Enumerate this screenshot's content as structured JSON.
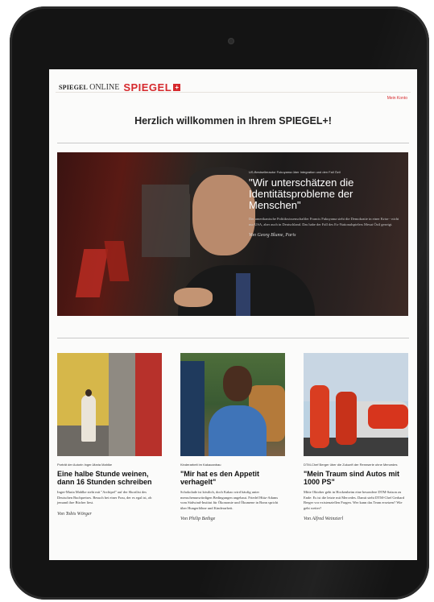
{
  "site": {
    "brand_spiegel": "SPIEGEL",
    "brand_online": "ONLINE",
    "brand_plus": "SPIEGEL",
    "brand_plus_sign": "+",
    "account_link": "Mein Konto"
  },
  "welcome": "Herzlich willkommen in Ihrem SPIEGEL+!",
  "hero": {
    "kicker": "US-Bestsellerautor Fukuyama über Integration und den Fall Özil",
    "title": "\"Wir unterschätzen die Identitätsprobleme der Menschen\"",
    "teaser": "Der amerikanische Politikwissenschaftler Francis Fukuyama sieht die Demokratie in einer Krise - nicht nur USA, aber auch in Deutschland. Das habe der Fall des Ex-Nationalspielers Mesut Özil gezeigt.",
    "author": "Von Georg Blume, Paris"
  },
  "articles": [
    {
      "kicker": "Porträt der Autorin Inger-Maria Mahlke",
      "title": "Eine halbe Stunde weinen, dann 16 Stunden schreiben",
      "teaser": "Inger-Maria Mahlke steht mit \"Archipel\" auf der Shortlist des Deutschen Buchpreises. Besuch bei einer Frau, der es egal ist, ob jemand ihre Bücher liest.",
      "author": "Von Tobis Wörger"
    },
    {
      "kicker": "Kinderarbeit im Kakaoanbau",
      "title": "\"Mir hat es den Appetit verhagelt\"",
      "teaser": "Schokolade ist köstlich, doch Kakao wird häufig unter menschenunwürdigen Bedingungen angebaut. Friedel Hütz-Adams vom Südwind-Institut für Ökonomie und Ökumene in Bonn spricht über Hungerlöhne und Kinderarbeit.",
      "author": "Von Philip Bethge"
    },
    {
      "kicker": "DTM-Chef Berger über die Zukunft der Rennserie ohne Mercedes",
      "title": "\"Mein Traum sind Autos mit 1000 PS\"",
      "teaser": "Mitte Oktober geht in Hockenheim eine besondere DTM-Saison zu Ende: Es ist die letzte mit Mercedes. Damit steht DTM-Chef Gerhard Berger vor existenziellen Fragen. Wer kann das Team ersetzen? Wie geht weiter?",
      "author": "Von Alfred Weinzierl"
    }
  ]
}
